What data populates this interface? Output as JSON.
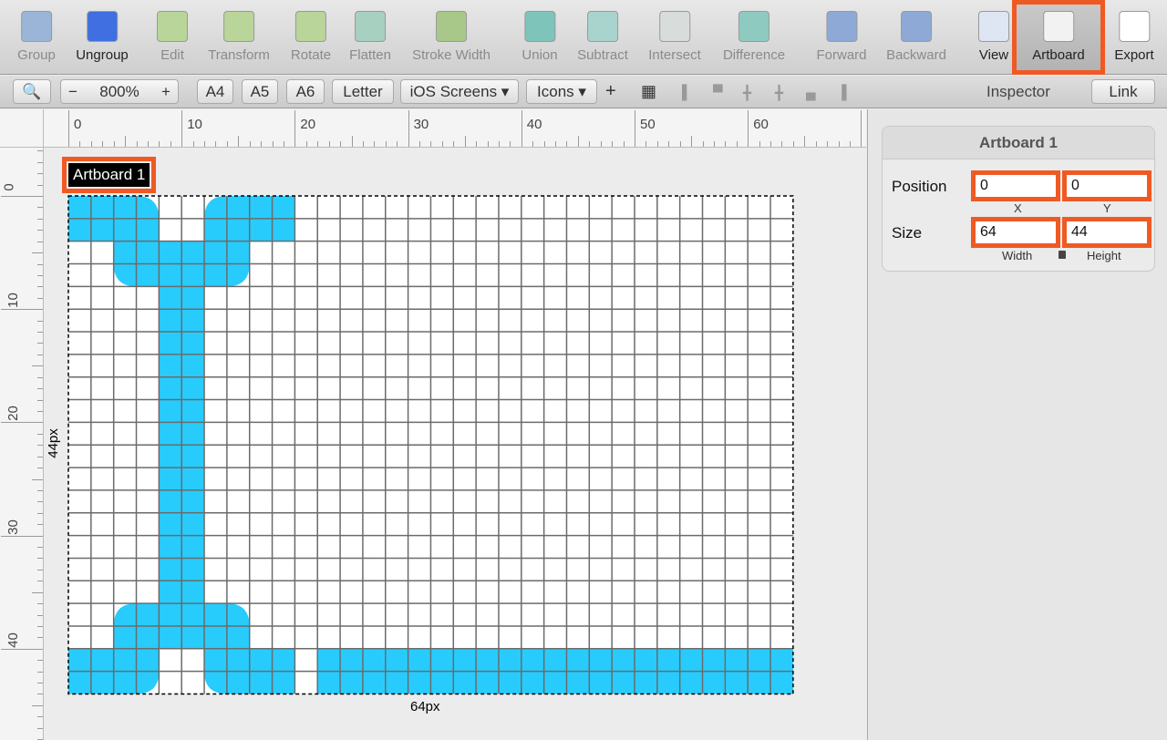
{
  "toolbar": {
    "items": [
      {
        "label": "Group",
        "icon": "group-icon",
        "color": "#9bb5d8",
        "dark": false
      },
      {
        "label": "Ungroup",
        "icon": "ungroup-icon",
        "color": "#3f6fe0",
        "dark": true
      },
      {
        "label": "Edit",
        "icon": "edit-icon",
        "color": "#b9d59a",
        "dark": false
      },
      {
        "label": "Transform",
        "icon": "transform-icon",
        "color": "#b9d59a",
        "dark": false
      },
      {
        "label": "Rotate",
        "icon": "rotate-icon",
        "color": "#b9d59a",
        "dark": false
      },
      {
        "label": "Flatten",
        "icon": "flatten-icon",
        "color": "#a8d0c0",
        "dark": false
      },
      {
        "label": "Stroke Width",
        "icon": "stroke-width-icon",
        "color": "#a8c88a",
        "dark": false
      },
      {
        "label": "Union",
        "icon": "union-icon",
        "color": "#7fc4bb",
        "dark": false
      },
      {
        "label": "Subtract",
        "icon": "subtract-icon",
        "color": "#a9d3cd",
        "dark": false
      },
      {
        "label": "Intersect",
        "icon": "intersect-icon",
        "color": "#d8dddc",
        "dark": false
      },
      {
        "label": "Difference",
        "icon": "difference-icon",
        "color": "#8fcac1",
        "dark": false
      },
      {
        "label": "Forward",
        "icon": "forward-icon",
        "color": "#8ea9d6",
        "dark": false
      },
      {
        "label": "Backward",
        "icon": "backward-icon",
        "color": "#8ea9d6",
        "dark": false
      },
      {
        "label": "View",
        "icon": "view-icon",
        "color": "#dde6f2",
        "dark": true
      },
      {
        "label": "Artboard",
        "icon": "artboard-icon",
        "color": "#f2f2f2",
        "dark": true
      },
      {
        "label": "Export",
        "icon": "export-icon",
        "color": "#ffffff",
        "dark": true
      }
    ]
  },
  "secondary": {
    "zoom": "800%",
    "zoom_out": "−",
    "zoom_in": "+",
    "presets": [
      "A4",
      "A5",
      "A6",
      "Letter"
    ],
    "ios_screens": "iOS Screens ▾",
    "icons": "Icons ▾",
    "add": "+",
    "inspector": "Inspector",
    "link": "Link"
  },
  "rulers": {
    "top": [
      "0",
      "10",
      "20",
      "30",
      "40",
      "50",
      "60"
    ],
    "left": [
      "0",
      "10",
      "20",
      "30",
      "40"
    ]
  },
  "artboard": {
    "name": "Artboard 1",
    "width_label": "64px",
    "height_label": "44px",
    "fill_color": "#27ccfd"
  },
  "inspector": {
    "title": "Artboard 1",
    "position_label": "Position",
    "size_label": "Size",
    "x": "0",
    "y": "0",
    "x_label": "X",
    "y_label": "Y",
    "width": "64",
    "height": "44",
    "width_label": "Width",
    "height_label": "Height"
  },
  "accent": "#ef5a24"
}
